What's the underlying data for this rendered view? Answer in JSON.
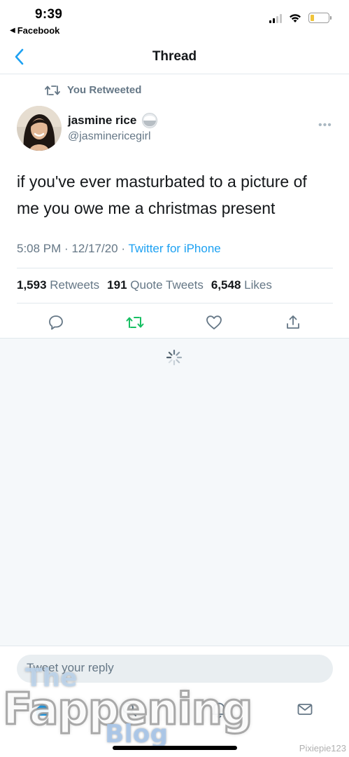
{
  "status_bar": {
    "time": "9:39",
    "back_app": "Facebook",
    "back_arrow": "◀"
  },
  "nav": {
    "title": "Thread",
    "back_icon": "chevron-left-icon"
  },
  "tweet": {
    "social_context": "You Retweeted",
    "author_name": "jasmine rice",
    "author_handle": "@jasminericegirl",
    "text": "if you've ever masturbated to a picture of me you owe me a christmas present",
    "time": "5:08 PM",
    "date": "12/17/20",
    "separator": "·",
    "source": "Twitter for iPhone",
    "stats": {
      "retweets_count": "1,593",
      "retweets_label": "Retweets",
      "quotes_count": "191",
      "quotes_label": "Quote Tweets",
      "likes_count": "6,548",
      "likes_label": "Likes"
    }
  },
  "reply": {
    "placeholder": "Tweet your reply"
  },
  "watermark": {
    "line1": "The",
    "line2": "Fappening",
    "line3": "Blog"
  },
  "credit": "Pixiepie123",
  "colors": {
    "accent": "#1da1f2",
    "retweet_active": "#17bf63",
    "secondary_text": "#657786",
    "battery_fill": "#f0c43a"
  }
}
